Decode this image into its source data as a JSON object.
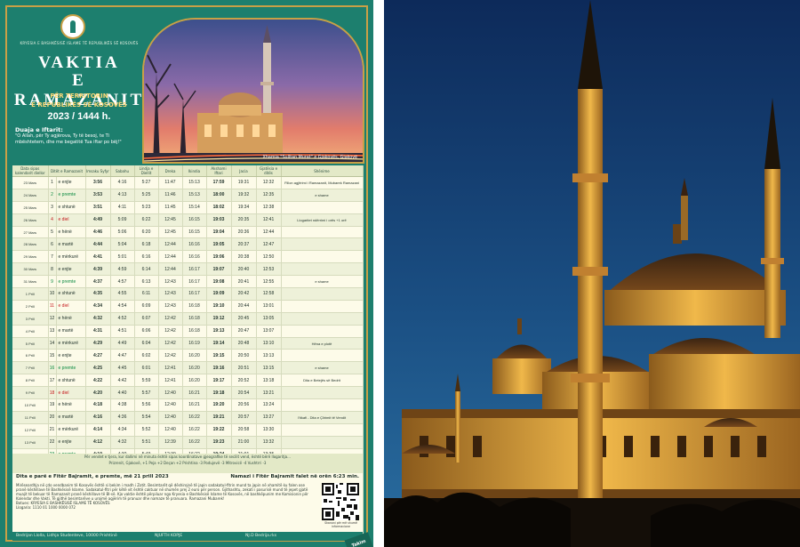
{
  "header": {
    "org_name": "KRYESIA E BASHKËSISË ISLAME TË REPUBLIKËS SË KOSOVËS",
    "title_line_1": "VAKTIA",
    "title_line_2": "E RAMAZANIT",
    "sub_line_1": "PËR TERRITORIN",
    "sub_line_2": "E REPUBLIKËS SË KOSOVËS",
    "year": "2023 / 1444 h."
  },
  "dua": {
    "title": "Duaja e Iftarit:",
    "text": "\"O Allah, për Ty agjërova, Ty të besoj, te Ti mbështetem, dhe me begatitë Tua iftar po bëj!\""
  },
  "photo": {
    "caption": "Xhamia \"Sulltan Murat\" e Gjakovës, Gjakovë"
  },
  "table": {
    "headers": [
      "Data sipas kalendarit diellor",
      "Ditët e Ramazanit",
      "Imsaku Syfyr",
      "Sabahu",
      "Lindja e Diellit",
      "Dreka",
      "Ikindia",
      "Akshami Iftari",
      "Jacia",
      "Gjatësia e ditës",
      "Shënime"
    ],
    "rows": [
      {
        "date": "23 Mars",
        "n": "1",
        "day": "e enjte",
        "dc": "",
        "imsak": "3:56",
        "sabah": "4:16",
        "lindja": "5:27",
        "dreka": "11:47",
        "ikindia": "15:13",
        "akshami": "17:59",
        "jacia": "19:31",
        "gjatesia": "12:32",
        "note": "Fillon agjërimi i Ramazanit, Mubarek Ramazani"
      },
      {
        "date": "24 Mars",
        "n": "2",
        "day": "e premte",
        "dc": "d-fri",
        "imsak": "3:53",
        "sabah": "4:13",
        "lindja": "5:25",
        "dreka": "11:46",
        "ikindia": "15:13",
        "akshami": "18:00",
        "jacia": "19:32",
        "gjatesia": "12:35",
        "note": "e shame"
      },
      {
        "date": "25 Mars",
        "n": "3",
        "day": "e shtunë",
        "dc": "",
        "imsak": "3:51",
        "sabah": "4:11",
        "lindja": "5:23",
        "dreka": "11:45",
        "ikindia": "15:14",
        "akshami": "18:02",
        "jacia": "19:34",
        "gjatesia": "12:38",
        "note": ""
      },
      {
        "date": "26 Mars",
        "n": "4",
        "day": "e diel",
        "dc": "d-sun",
        "imsak": "4:49",
        "sabah": "5:09",
        "lindja": "6:22",
        "dreka": "12:45",
        "ikindia": "16:15",
        "akshami": "19:03",
        "jacia": "20:35",
        "gjatesia": "12:41",
        "note": "Llogaritet ndërrimi i orës +1 orë"
      },
      {
        "date": "27 Mars",
        "n": "5",
        "day": "e hënë",
        "dc": "",
        "imsak": "4:46",
        "sabah": "5:06",
        "lindja": "6:20",
        "dreka": "12:45",
        "ikindia": "16:15",
        "akshami": "19:04",
        "jacia": "20:36",
        "gjatesia": "12:44",
        "note": ""
      },
      {
        "date": "28 Mars",
        "n": "6",
        "day": "e martë",
        "dc": "",
        "imsak": "4:44",
        "sabah": "5:04",
        "lindja": "6:18",
        "dreka": "12:44",
        "ikindia": "16:16",
        "akshami": "19:05",
        "jacia": "20:37",
        "gjatesia": "12:47",
        "note": ""
      },
      {
        "date": "29 Mars",
        "n": "7",
        "day": "e mërkurë",
        "dc": "",
        "imsak": "4:41",
        "sabah": "5:01",
        "lindja": "6:16",
        "dreka": "12:44",
        "ikindia": "16:16",
        "akshami": "19:06",
        "jacia": "20:38",
        "gjatesia": "12:50",
        "note": ""
      },
      {
        "date": "30 Mars",
        "n": "8",
        "day": "e enjte",
        "dc": "",
        "imsak": "4:39",
        "sabah": "4:59",
        "lindja": "6:14",
        "dreka": "12:44",
        "ikindia": "16:17",
        "akshami": "19:07",
        "jacia": "20:40",
        "gjatesia": "12:53",
        "note": ""
      },
      {
        "date": "31 Mars",
        "n": "9",
        "day": "e premte",
        "dc": "d-fri",
        "imsak": "4:37",
        "sabah": "4:57",
        "lindja": "6:13",
        "dreka": "12:43",
        "ikindia": "16:17",
        "akshami": "19:08",
        "jacia": "20:41",
        "gjatesia": "12:55",
        "note": "e shame"
      },
      {
        "date": "1 Prill",
        "n": "10",
        "day": "e shtunë",
        "dc": "",
        "imsak": "4:35",
        "sabah": "4:55",
        "lindja": "6:11",
        "dreka": "12:43",
        "ikindia": "16:17",
        "akshami": "19:09",
        "jacia": "20:42",
        "gjatesia": "12:58",
        "note": ""
      },
      {
        "date": "2 Prill",
        "n": "11",
        "day": "e diel",
        "dc": "d-sun",
        "imsak": "4:34",
        "sabah": "4:54",
        "lindja": "6:09",
        "dreka": "12:43",
        "ikindia": "16:18",
        "akshami": "19:10",
        "jacia": "20:44",
        "gjatesia": "13:01",
        "note": ""
      },
      {
        "date": "3 Prill",
        "n": "12",
        "day": "e hënë",
        "dc": "",
        "imsak": "4:32",
        "sabah": "4:52",
        "lindja": "6:07",
        "dreka": "12:42",
        "ikindia": "16:18",
        "akshami": "19:12",
        "jacia": "20:45",
        "gjatesia": "13:05",
        "note": ""
      },
      {
        "date": "4 Prill",
        "n": "13",
        "day": "e martë",
        "dc": "",
        "imsak": "4:31",
        "sabah": "4:51",
        "lindja": "6:06",
        "dreka": "12:42",
        "ikindia": "16:18",
        "akshami": "19:13",
        "jacia": "20:47",
        "gjatesia": "13:07",
        "note": ""
      },
      {
        "date": "5 Prill",
        "n": "14",
        "day": "e mërkurë",
        "dc": "",
        "imsak": "4:29",
        "sabah": "4:49",
        "lindja": "6:04",
        "dreka": "12:42",
        "ikindia": "16:19",
        "akshami": "19:14",
        "jacia": "20:48",
        "gjatesia": "13:10",
        "note": "Hëna e plotë"
      },
      {
        "date": "6 Prill",
        "n": "15",
        "day": "e enjte",
        "dc": "",
        "imsak": "4:27",
        "sabah": "4:47",
        "lindja": "6:02",
        "dreka": "12:42",
        "ikindia": "16:20",
        "akshami": "19:15",
        "jacia": "20:50",
        "gjatesia": "13:13",
        "note": ""
      },
      {
        "date": "7 Prill",
        "n": "16",
        "day": "e premte",
        "dc": "d-fri",
        "imsak": "4:25",
        "sabah": "4:45",
        "lindja": "6:01",
        "dreka": "12:41",
        "ikindia": "16:20",
        "akshami": "19:16",
        "jacia": "20:51",
        "gjatesia": "13:15",
        "note": "e shame"
      },
      {
        "date": "8 Prill",
        "n": "17",
        "day": "e shtunë",
        "dc": "",
        "imsak": "4:22",
        "sabah": "4:42",
        "lindja": "5:59",
        "dreka": "12:41",
        "ikindia": "16:20",
        "akshami": "19:17",
        "jacia": "20:52",
        "gjatesia": "13:18",
        "note": "Dita e Betejës së Bedrit"
      },
      {
        "date": "9 Prill",
        "n": "18",
        "day": "e diel",
        "dc": "d-sun",
        "imsak": "4:20",
        "sabah": "4:40",
        "lindja": "5:57",
        "dreka": "12:40",
        "ikindia": "16:21",
        "akshami": "19:18",
        "jacia": "20:54",
        "gjatesia": "13:21",
        "note": ""
      },
      {
        "date": "10 Prill",
        "n": "19",
        "day": "e hënë",
        "dc": "",
        "imsak": "4:18",
        "sabah": "4:38",
        "lindja": "5:56",
        "dreka": "12:40",
        "ikindia": "16:21",
        "akshami": "19:20",
        "jacia": "20:56",
        "gjatesia": "13:24",
        "note": ""
      },
      {
        "date": "11 Prill",
        "n": "20",
        "day": "e martë",
        "dc": "",
        "imsak": "4:16",
        "sabah": "4:36",
        "lindja": "5:54",
        "dreka": "12:40",
        "ikindia": "16:22",
        "akshami": "19:21",
        "jacia": "20:57",
        "gjatesia": "13:27",
        "note": "I'tikafi - Dita e Çlirimit të Vendit"
      },
      {
        "date": "12 Prill",
        "n": "21",
        "day": "e mërkurë",
        "dc": "",
        "imsak": "4:14",
        "sabah": "4:34",
        "lindja": "5:52",
        "dreka": "12:40",
        "ikindia": "16:22",
        "akshami": "19:22",
        "jacia": "20:58",
        "gjatesia": "13:30",
        "note": ""
      },
      {
        "date": "13 Prill",
        "n": "22",
        "day": "e enjte",
        "dc": "",
        "imsak": "4:12",
        "sabah": "4:32",
        "lindja": "5:51",
        "dreka": "12:39",
        "ikindia": "16:22",
        "akshami": "19:23",
        "jacia": "21:00",
        "gjatesia": "13:32",
        "note": ""
      },
      {
        "date": "14 Prill",
        "n": "23",
        "day": "e premte",
        "dc": "d-fri",
        "imsak": "4:10",
        "sabah": "4:30",
        "lindja": "5:49",
        "dreka": "12:39",
        "ikindia": "16:22",
        "akshami": "19:24",
        "jacia": "21:01",
        "gjatesia": "13:35",
        "note": "e shame"
      },
      {
        "date": "15 Prill",
        "n": "24",
        "day": "e shtunë",
        "dc": "",
        "imsak": "4:08",
        "sabah": "4:28",
        "lindja": "5:48",
        "dreka": "12:39",
        "ikindia": "16:22",
        "akshami": "19:25",
        "jacia": "21:02",
        "gjatesia": "13:37",
        "note": ""
      },
      {
        "date": "16 Prill",
        "n": "25",
        "day": "e diel",
        "dc": "d-sun",
        "imsak": "4:06",
        "sabah": "4:26",
        "lindja": "5:46",
        "dreka": "12:38",
        "ikindia": "16:22",
        "akshami": "19:26",
        "jacia": "21:03",
        "gjatesia": "13:40",
        "note": ""
      },
      {
        "date": "17 Prill",
        "n": "26",
        "day": "e hënë",
        "dc": "",
        "imsak": "4:05",
        "sabah": "4:25",
        "lindja": "5:44",
        "dreka": "12:38",
        "ikindia": "16:22",
        "akshami": "19:27",
        "jacia": "21:05",
        "gjatesia": "13:43",
        "note": "Nata e madhe e Kadrit"
      },
      {
        "date": "18 Prill",
        "n": "27",
        "day": "e martë",
        "dc": "",
        "imsak": "4:03",
        "sabah": "4:23",
        "lindja": "5:43",
        "dreka": "12:38",
        "ikindia": "16:23",
        "akshami": "19:28",
        "jacia": "21:06",
        "gjatesia": "13:45",
        "note": ""
      },
      {
        "date": "19 Prill",
        "n": "28",
        "day": "e mërkurë",
        "dc": "",
        "imsak": "4:01",
        "sabah": "4:21",
        "lindja": "5:40",
        "dreka": "12:37",
        "ikindia": "16:23",
        "akshami": "19:29",
        "jacia": "21:08",
        "gjatesia": "13:49",
        "note": ""
      },
      {
        "date": "20 Prill",
        "n": "29",
        "day": "e enjte",
        "dc": "",
        "imsak": "3:59",
        "sabah": "4:19",
        "lindja": "5:36",
        "dreka": "12:37",
        "ikindia": "16:23",
        "akshami": "19:31",
        "jacia": "21:10",
        "gjatesia": "13:52",
        "note": "Nata e Fitër Bajramit"
      }
    ]
  },
  "notes": {
    "line_1": "Për vendet e tjera, kur dallimi në minuta është sipas koordinatave gjeografike të secilit vend, është bërë llogaritja…",
    "line_2": "Prizrenit, Gjakovë, +1 Peja +2 Deçan +2 Prishtina -3 Podujevë -3 Mitrovicë -4 Vushtrri -3"
  },
  "bajram": {
    "left": "Dita e parë e Fitër Bajramit, e premte, më 21 prill 2023",
    "right": "Namazi i Fitër Bajramit falet në orën 6:23 min."
  },
  "info": {
    "text": "Mirëseardhja në çdo vendbanim të Kosovës është si bekim i madh i Zotit. Besimtarët që dëshirojnë të japin sadakatul-fitrin mund ta japin në xhamitë ku falen ose pranë këshillave të Bashkësisë Islame. Sadakatul-fitri për këtë vit është caktuar në shumën prej 2 euro për person. Gjithashtu, zekati i pasurisë mund të jepet gjatë muajit të bekuar të Ramazanit pranë këshillave të BI-së. Kjo vaktie është përpiluar nga Kryesia e Bashkësisë Islame të Kosovës, në bashkëpunim me Komisionin për Kalendar dhe Vakti. Të gjithë besimtarëve u urojmë agjërim të pranuar dhe namaze të pranuara. Ramazani Mubarek!",
    "legal": "Botues: KRYESIA E BASHKËSISË ISLAME TË KOSOVËS",
    "isbn": "Llogaria: 1110 01 1000 0000 072"
  },
  "qr": {
    "caption": "Skanoni për më shumë informacione"
  },
  "footer": {
    "left": "Bedrijan Llolla, Lidhja Studenteve, 10000 Prishtinë",
    "center": "NJUFTH KOPJE",
    "right": "NJ.D Bedrija.rks"
  },
  "publisher_tag": "Takim"
}
